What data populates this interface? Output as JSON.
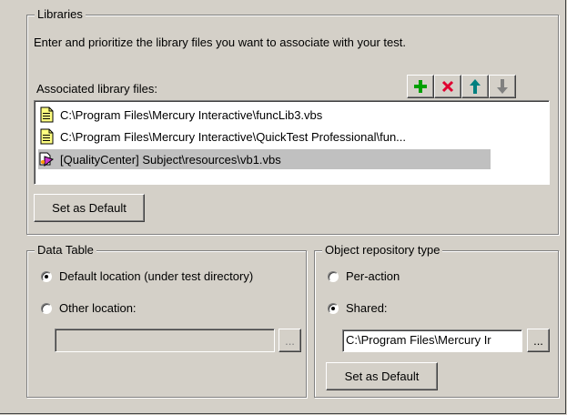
{
  "libraries": {
    "group_label": "Libraries",
    "description": "Enter and prioritize the library files you want to associate with your test.",
    "list_label": "Associated library files:",
    "toolbar": {
      "add_icon": "green-plus-icon",
      "remove_icon": "red-x-icon",
      "up_icon": "arrow-up-icon",
      "down_icon": "arrow-down-icon",
      "colors": {
        "add": "#00a000",
        "remove": "#e00030",
        "up": "#008080",
        "down": "#808080"
      }
    },
    "files": [
      {
        "path": "C:\\Program Files\\Mercury Interactive\\funcLib3.vbs",
        "icon": "document-icon",
        "selected": false
      },
      {
        "path": "C:\\Program Files\\Mercury Interactive\\QuickTest Professional\\fun...",
        "icon": "document-icon",
        "selected": false
      },
      {
        "path": "[QualityCenter] Subject\\resources\\vb1.vbs",
        "icon": "quality-center-icon",
        "selected": true
      }
    ],
    "set_default_label": "Set as Default"
  },
  "data_table": {
    "group_label": "Data Table",
    "default_label": "Default location (under test directory)",
    "default_selected": true,
    "other_label": "Other location:",
    "other_selected": false,
    "path_value": "",
    "browse_label": "..."
  },
  "object_repository": {
    "group_label": "Object repository type",
    "per_action_label": "Per-action",
    "per_action_selected": false,
    "shared_label": "Shared:",
    "shared_selected": true,
    "path_value": "C:\\Program Files\\Mercury Ir",
    "browse_label": "...",
    "set_default_label": "Set as Default"
  }
}
